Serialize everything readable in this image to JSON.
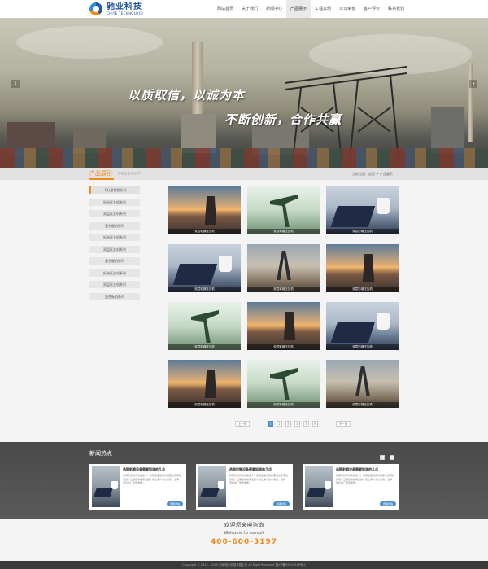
{
  "header": {
    "logo_cn": "驰业科技",
    "logo_en": "CHIYE TECHNOLOGY",
    "nav": [
      {
        "label": "网站首页",
        "active": false
      },
      {
        "label": "关于我们",
        "active": false
      },
      {
        "label": "新闻中心",
        "active": false
      },
      {
        "label": "产品展示",
        "active": true
      },
      {
        "label": "工程案例",
        "active": false
      },
      {
        "label": "公司荣誉",
        "active": false
      },
      {
        "label": "客户评价",
        "active": false
      },
      {
        "label": "联系我们",
        "active": false
      }
    ]
  },
  "banner": {
    "slogan_1": "以质取信，以诚为本",
    "slogan_2": "不断创新，合作共赢",
    "prev_icon": "chevron-left-icon",
    "next_icon": "chevron-right-icon"
  },
  "products": {
    "title": "产品展示",
    "title_en": "PRODUCT",
    "breadcrumb": "当前位置：首页 > 产品展示",
    "sidebar": [
      "C分型钢机系列",
      "折结压支机系列",
      "双层压支机系列",
      "复合板机系列",
      "折结压支机系列",
      "双层压支机系列",
      "复合板机系列",
      "折结压支机系列",
      "双层压支机系列",
      "复合板机系列"
    ],
    "items": [
      {
        "caption": "双层彩钢压瓦机",
        "image": "sunset"
      },
      {
        "caption": "双层彩钢压瓦机",
        "image": "pump"
      },
      {
        "caption": "双层彩钢压瓦机",
        "image": "desk"
      },
      {
        "caption": "双层彩钢压瓦机",
        "image": "desk"
      },
      {
        "caption": "双层彩钢压瓦机",
        "image": "mine"
      },
      {
        "caption": "双层彩钢压瓦机",
        "image": "sunset"
      },
      {
        "caption": "双层彩钢压瓦机",
        "image": "pump"
      },
      {
        "caption": "双层彩钢压瓦机",
        "image": "sunset"
      },
      {
        "caption": "双层彩钢压瓦机",
        "image": "desk"
      },
      {
        "caption": "双层彩钢压瓦机",
        "image": "sunset"
      },
      {
        "caption": "双层彩钢压瓦机",
        "image": "pump"
      },
      {
        "caption": "双层彩钢压瓦机",
        "image": "mine"
      }
    ]
  },
  "pagination": {
    "prev": "上一页",
    "next": "下一页",
    "pages": [
      "1",
      "2",
      "3",
      "4",
      "5",
      "6"
    ],
    "current": "1"
  },
  "news": {
    "title": "新闻热点",
    "prev_icon": "chevron-left-icon",
    "next_icon": "chevron-right-icon",
    "items": [
      {
        "headline": "选购彩钢设备需要知道的几点",
        "body": "彩钢压瓦机寿命是多少？彩钢设备选购时需要注意哪些问题？正确选购彩钢设备才能让客户放心使用，选择一家好的厂家很重要…",
        "more": "查看详情"
      },
      {
        "headline": "选购彩钢设备需要知道的几点",
        "body": "彩钢压瓦机寿命是多少？彩钢设备选购时需要注意哪些问题？正确选购彩钢设备才能让客户放心使用，选择一家好的厂家很重要…",
        "more": "查看详情"
      },
      {
        "headline": "选购彩钢设备需要知道的几点",
        "body": "彩钢压瓦机寿命是多少？彩钢设备选购时需要注意哪些问题？正确选购彩钢设备才能让客户放心使用，选择一家好的厂家很重要…",
        "more": "查看详情"
      }
    ]
  },
  "consult": {
    "title_cn": "欢迎您来电咨询",
    "title_en": "Welcome to consult",
    "phone": "400-600-3197"
  },
  "footer": {
    "text": "Copyright © 2014 - 2015  河北驰业科技有限公司 All Right Reserved    冀ICP备09010319号-1"
  },
  "colors": {
    "accent": "#f08a1c",
    "brand": "#1e4f9c",
    "link": "#4e8fd1"
  }
}
